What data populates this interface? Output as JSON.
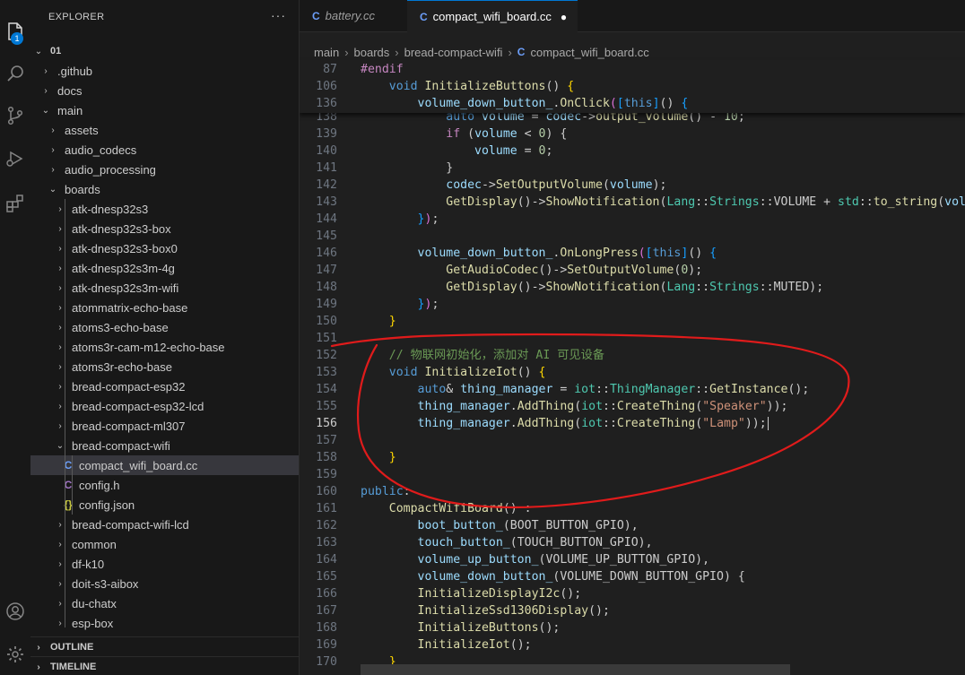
{
  "explorer": {
    "title": "EXPLORER",
    "root": "01",
    "badge": "1",
    "more": "···",
    "tree": [
      {
        "label": ".github",
        "type": "folder",
        "open": false,
        "depth": 1
      },
      {
        "label": "docs",
        "type": "folder",
        "open": false,
        "depth": 1
      },
      {
        "label": "main",
        "type": "folder",
        "open": true,
        "depth": 1
      },
      {
        "label": "assets",
        "type": "folder",
        "open": false,
        "depth": 2
      },
      {
        "label": "audio_codecs",
        "type": "folder",
        "open": false,
        "depth": 2
      },
      {
        "label": "audio_processing",
        "type": "folder",
        "open": false,
        "depth": 2
      },
      {
        "label": "boards",
        "type": "folder",
        "open": true,
        "depth": 2
      },
      {
        "label": "atk-dnesp32s3",
        "type": "folder",
        "open": false,
        "depth": 3
      },
      {
        "label": "atk-dnesp32s3-box",
        "type": "folder",
        "open": false,
        "depth": 3
      },
      {
        "label": "atk-dnesp32s3-box0",
        "type": "folder",
        "open": false,
        "depth": 3
      },
      {
        "label": "atk-dnesp32s3m-4g",
        "type": "folder",
        "open": false,
        "depth": 3
      },
      {
        "label": "atk-dnesp32s3m-wifi",
        "type": "folder",
        "open": false,
        "depth": 3
      },
      {
        "label": "atommatrix-echo-base",
        "type": "folder",
        "open": false,
        "depth": 3
      },
      {
        "label": "atoms3-echo-base",
        "type": "folder",
        "open": false,
        "depth": 3
      },
      {
        "label": "atoms3r-cam-m12-echo-base",
        "type": "folder",
        "open": false,
        "depth": 3
      },
      {
        "label": "atoms3r-echo-base",
        "type": "folder",
        "open": false,
        "depth": 3
      },
      {
        "label": "bread-compact-esp32",
        "type": "folder",
        "open": false,
        "depth": 3
      },
      {
        "label": "bread-compact-esp32-lcd",
        "type": "folder",
        "open": false,
        "depth": 3
      },
      {
        "label": "bread-compact-ml307",
        "type": "folder",
        "open": false,
        "depth": 3
      },
      {
        "label": "bread-compact-wifi",
        "type": "folder",
        "open": true,
        "depth": 3
      },
      {
        "label": "compact_wifi_board.cc",
        "type": "cpp",
        "depth": 4,
        "selected": true
      },
      {
        "label": "config.h",
        "type": "h",
        "depth": 4
      },
      {
        "label": "config.json",
        "type": "json",
        "depth": 4
      },
      {
        "label": "bread-compact-wifi-lcd",
        "type": "folder",
        "open": false,
        "depth": 3
      },
      {
        "label": "common",
        "type": "folder",
        "open": false,
        "depth": 3
      },
      {
        "label": "df-k10",
        "type": "folder",
        "open": false,
        "depth": 3
      },
      {
        "label": "doit-s3-aibox",
        "type": "folder",
        "open": false,
        "depth": 3
      },
      {
        "label": "du-chatx",
        "type": "folder",
        "open": false,
        "depth": 3
      },
      {
        "label": "esp-box",
        "type": "folder",
        "open": false,
        "depth": 3
      }
    ],
    "sections": [
      "OUTLINE",
      "TIMELINE"
    ]
  },
  "tabs": [
    {
      "label": "battery.cc",
      "italic": true,
      "active": false
    },
    {
      "label": "compact_wifi_board.cc",
      "italic": false,
      "active": true,
      "dirty": "●"
    }
  ],
  "breadcrumb": [
    "main",
    "boards",
    "bread-compact-wifi",
    "compact_wifi_board.cc"
  ],
  "sticky_lines": [
    {
      "n": "87",
      "t": [
        [
          "#endif",
          "ctl"
        ]
      ]
    },
    {
      "n": "106",
      "t": [
        [
          "    ",
          ""
        ],
        [
          "void",
          "kw"
        ],
        [
          " ",
          ""
        ],
        [
          "InitializeButtons",
          "fn"
        ],
        [
          "() ",
          ""
        ],
        [
          "{",
          "br1"
        ]
      ]
    },
    {
      "n": "136",
      "t": [
        [
          "        ",
          ""
        ],
        [
          "volume_down_button_",
          "var"
        ],
        [
          ".",
          ""
        ],
        [
          "OnClick",
          "fn"
        ],
        [
          "(",
          "br2"
        ],
        [
          "[",
          "br3"
        ],
        [
          "this",
          "kw"
        ],
        [
          "]",
          "br3"
        ],
        [
          "() ",
          ""
        ],
        [
          "{",
          "br3"
        ]
      ]
    }
  ],
  "lines": [
    {
      "n": "138",
      "t": [
        [
          "            ",
          ""
        ],
        [
          "auto",
          "kw"
        ],
        [
          " ",
          ""
        ],
        [
          "volume",
          "var"
        ],
        [
          " = ",
          ""
        ],
        [
          "codec",
          "var"
        ],
        [
          "->",
          ""
        ],
        [
          "output_volume",
          "fn"
        ],
        [
          "() - ",
          ""
        ],
        [
          "10",
          "num"
        ],
        [
          ";",
          ""
        ]
      ]
    },
    {
      "n": "139",
      "t": [
        [
          "            ",
          ""
        ],
        [
          "if",
          "ctl"
        ],
        [
          " (",
          ""
        ],
        [
          "volume",
          "var"
        ],
        [
          " < ",
          ""
        ],
        [
          "0",
          "num"
        ],
        [
          ") {",
          ""
        ]
      ]
    },
    {
      "n": "140",
      "t": [
        [
          "                ",
          ""
        ],
        [
          "volume",
          "var"
        ],
        [
          " = ",
          ""
        ],
        [
          "0",
          "num"
        ],
        [
          ";",
          ""
        ]
      ]
    },
    {
      "n": "141",
      "t": [
        [
          "            }",
          ""
        ]
      ]
    },
    {
      "n": "142",
      "t": [
        [
          "            ",
          ""
        ],
        [
          "codec",
          "var"
        ],
        [
          "->",
          ""
        ],
        [
          "SetOutputVolume",
          "fn"
        ],
        [
          "(",
          ""
        ],
        [
          "volume",
          "var"
        ],
        [
          ");",
          ""
        ]
      ]
    },
    {
      "n": "143",
      "t": [
        [
          "            ",
          ""
        ],
        [
          "GetDisplay",
          "fn"
        ],
        [
          "()->",
          ""
        ],
        [
          "ShowNotification",
          "fn"
        ],
        [
          "(",
          ""
        ],
        [
          "Lang",
          "ty"
        ],
        [
          "::",
          ""
        ],
        [
          "Strings",
          "ty"
        ],
        [
          "::VOLUME + ",
          ""
        ],
        [
          "std",
          "ty"
        ],
        [
          "::",
          ""
        ],
        [
          "to_string",
          "fn"
        ],
        [
          "(",
          ""
        ],
        [
          "volume",
          "var"
        ]
      ]
    },
    {
      "n": "144",
      "t": [
        [
          "        ",
          ""
        ],
        [
          "}",
          "br3"
        ],
        [
          ")",
          "br2"
        ],
        [
          ";",
          ""
        ]
      ]
    },
    {
      "n": "145",
      "t": []
    },
    {
      "n": "146",
      "t": [
        [
          "        ",
          ""
        ],
        [
          "volume_down_button_",
          "var"
        ],
        [
          ".",
          ""
        ],
        [
          "OnLongPress",
          "fn"
        ],
        [
          "(",
          "br2"
        ],
        [
          "[",
          "br3"
        ],
        [
          "this",
          "kw"
        ],
        [
          "]",
          "br3"
        ],
        [
          "() ",
          ""
        ],
        [
          "{",
          "br3"
        ]
      ]
    },
    {
      "n": "147",
      "t": [
        [
          "            ",
          ""
        ],
        [
          "GetAudioCodec",
          "fn"
        ],
        [
          "()->",
          ""
        ],
        [
          "SetOutputVolume",
          "fn"
        ],
        [
          "(",
          ""
        ],
        [
          "0",
          "num"
        ],
        [
          ");",
          ""
        ]
      ]
    },
    {
      "n": "148",
      "t": [
        [
          "            ",
          ""
        ],
        [
          "GetDisplay",
          "fn"
        ],
        [
          "()->",
          ""
        ],
        [
          "ShowNotification",
          "fn"
        ],
        [
          "(",
          ""
        ],
        [
          "Lang",
          "ty"
        ],
        [
          "::",
          ""
        ],
        [
          "Strings",
          "ty"
        ],
        [
          "::MUTED);",
          ""
        ]
      ]
    },
    {
      "n": "149",
      "t": [
        [
          "        ",
          ""
        ],
        [
          "}",
          "br3"
        ],
        [
          ")",
          "br2"
        ],
        [
          ";",
          ""
        ]
      ]
    },
    {
      "n": "150",
      "t": [
        [
          "    ",
          ""
        ],
        [
          "}",
          "br1"
        ]
      ]
    },
    {
      "n": "151",
      "t": []
    },
    {
      "n": "152",
      "t": [
        [
          "    ",
          ""
        ],
        [
          "// 物联网初始化，添加对 AI 可见设备",
          "cm"
        ]
      ]
    },
    {
      "n": "153",
      "t": [
        [
          "    ",
          ""
        ],
        [
          "void",
          "kw"
        ],
        [
          " ",
          ""
        ],
        [
          "InitializeIot",
          "fn"
        ],
        [
          "() ",
          ""
        ],
        [
          "{",
          "br1"
        ]
      ]
    },
    {
      "n": "154",
      "t": [
        [
          "        ",
          ""
        ],
        [
          "auto",
          "kw"
        ],
        [
          "& ",
          ""
        ],
        [
          "thing_manager",
          "var"
        ],
        [
          " = ",
          ""
        ],
        [
          "iot",
          "ty"
        ],
        [
          "::",
          ""
        ],
        [
          "ThingManager",
          "ty"
        ],
        [
          "::",
          ""
        ],
        [
          "GetInstance",
          "fn"
        ],
        [
          "();",
          ""
        ]
      ]
    },
    {
      "n": "155",
      "t": [
        [
          "        ",
          ""
        ],
        [
          "thing_manager",
          "var"
        ],
        [
          ".",
          ""
        ],
        [
          "AddThing",
          "fn"
        ],
        [
          "(",
          ""
        ],
        [
          "iot",
          "ty"
        ],
        [
          "::",
          ""
        ],
        [
          "CreateThing",
          "fn"
        ],
        [
          "(",
          ""
        ],
        [
          "\"Speaker\"",
          "str"
        ],
        [
          "));",
          ""
        ]
      ]
    },
    {
      "n": "156",
      "t": [
        [
          "        ",
          ""
        ],
        [
          "thing_manager",
          "var"
        ],
        [
          ".",
          ""
        ],
        [
          "AddThing",
          "fn"
        ],
        [
          "(",
          ""
        ],
        [
          "iot",
          "ty"
        ],
        [
          "::",
          ""
        ],
        [
          "CreateThing",
          "fn"
        ],
        [
          "(",
          ""
        ],
        [
          "\"Lamp\"",
          "str"
        ],
        [
          "));",
          ""
        ]
      ],
      "current": true
    },
    {
      "n": "157",
      "t": []
    },
    {
      "n": "158",
      "t": [
        [
          "    ",
          ""
        ],
        [
          "}",
          "br1"
        ]
      ]
    },
    {
      "n": "159",
      "t": []
    },
    {
      "n": "160",
      "t": [
        [
          "public",
          "kw"
        ],
        [
          ":",
          ""
        ]
      ]
    },
    {
      "n": "161",
      "t": [
        [
          "    ",
          ""
        ],
        [
          "CompactWifiBoard",
          "fn"
        ],
        [
          "() :",
          ""
        ]
      ]
    },
    {
      "n": "162",
      "t": [
        [
          "        ",
          ""
        ],
        [
          "boot_button_",
          "var"
        ],
        [
          "(BOOT_BUTTON_GPIO),",
          ""
        ]
      ]
    },
    {
      "n": "163",
      "t": [
        [
          "        ",
          ""
        ],
        [
          "touch_button_",
          "var"
        ],
        [
          "(TOUCH_BUTTON_GPIO),",
          ""
        ]
      ]
    },
    {
      "n": "164",
      "t": [
        [
          "        ",
          ""
        ],
        [
          "volume_up_button_",
          "var"
        ],
        [
          "(VOLUME_UP_BUTTON_GPIO),",
          ""
        ]
      ]
    },
    {
      "n": "165",
      "t": [
        [
          "        ",
          ""
        ],
        [
          "volume_down_button_",
          "var"
        ],
        [
          "(VOLUME_DOWN_BUTTON_GPIO) {",
          ""
        ]
      ]
    },
    {
      "n": "166",
      "t": [
        [
          "        ",
          ""
        ],
        [
          "InitializeDisplayI2c",
          "fn"
        ],
        [
          "();",
          ""
        ]
      ]
    },
    {
      "n": "167",
      "t": [
        [
          "        ",
          ""
        ],
        [
          "InitializeSsd1306Display",
          "fn"
        ],
        [
          "();",
          ""
        ]
      ]
    },
    {
      "n": "168",
      "t": [
        [
          "        ",
          ""
        ],
        [
          "InitializeButtons",
          "fn"
        ],
        [
          "();",
          ""
        ]
      ]
    },
    {
      "n": "169",
      "t": [
        [
          "        ",
          ""
        ],
        [
          "InitializeIot",
          "fn"
        ],
        [
          "();",
          ""
        ]
      ]
    },
    {
      "n": "170",
      "t": [
        [
          "    ",
          ""
        ],
        [
          "}",
          "br1"
        ]
      ]
    }
  ],
  "colors": {
    "accent": "#0078d4",
    "annotation": "#e01b1b"
  }
}
